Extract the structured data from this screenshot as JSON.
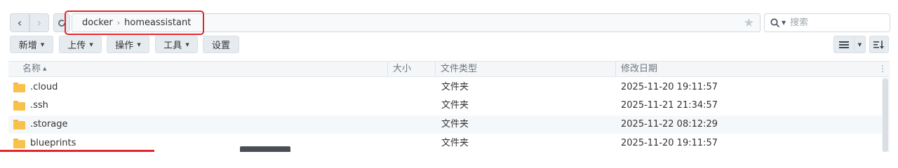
{
  "navigation": {
    "back_icon": "chevron-left-icon",
    "forward_icon": "chevron-right-icon",
    "refresh_icon": "refresh-icon"
  },
  "path": {
    "segments": [
      "docker",
      "homeassistant"
    ],
    "separator": "›",
    "favorite_icon": "star-icon",
    "highlight_color": "#e0262c"
  },
  "search": {
    "placeholder": "搜索",
    "icon": "search-icon"
  },
  "toolbar": {
    "create_label": "新增",
    "upload_label": "上传",
    "action_label": "操作",
    "tools_label": "工具",
    "settings_label": "设置"
  },
  "view": {
    "list_icon": "list-view-icon",
    "sort_icon": "sort-icon"
  },
  "table": {
    "columns": {
      "name": "名称",
      "size": "大小",
      "type": "文件类型",
      "modified": "修改日期"
    },
    "rows": [
      {
        "name": ".cloud",
        "size": "",
        "type": "文件夹",
        "modified": "2025-11-20 19:11:57"
      },
      {
        "name": ".ssh",
        "size": "",
        "type": "文件夹",
        "modified": "2025-11-21 21:34:57"
      },
      {
        "name": ".storage",
        "size": "",
        "type": "文件夹",
        "modified": "2025-11-22 08:12:29"
      },
      {
        "name": "blueprints",
        "size": "",
        "type": "文件夹",
        "modified": "2025-11-20 19:11:57"
      }
    ]
  },
  "colors": {
    "button_bg": "#e6ebf0",
    "folder": "#f8c14a",
    "row_alt": "#f5f8fb"
  }
}
